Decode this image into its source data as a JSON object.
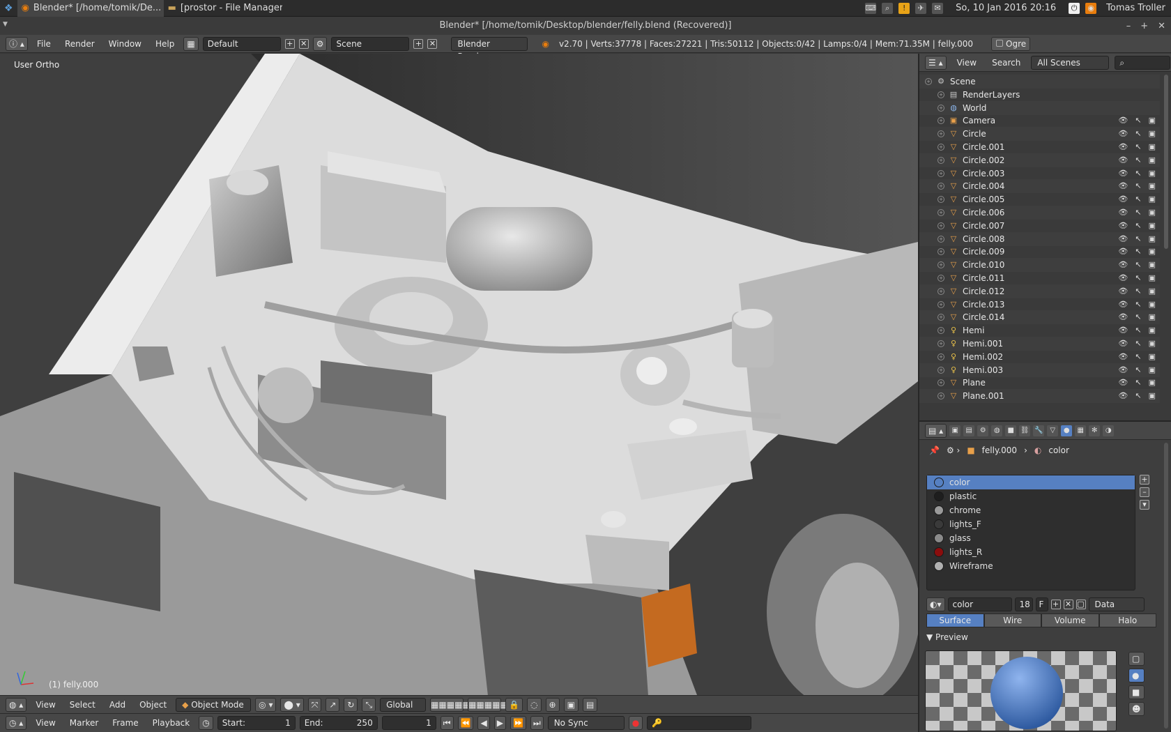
{
  "system": {
    "tasks": [
      {
        "label": "Blender* [/home/tomik/De..."
      },
      {
        "label": "[prostor - File Manager]"
      }
    ],
    "clock": "So, 10 Jan 2016 20:16",
    "user": "Tomas Troller"
  },
  "window": {
    "title": "Blender* [/home/tomik/Desktop/blender/felly.blend (Recovered)]"
  },
  "info_header": {
    "menus": [
      "File",
      "Render",
      "Window",
      "Help"
    ],
    "layout": "Default",
    "scene": "Scene",
    "engine": "Blender Render",
    "stats": "v2.70 | Verts:37778 | Faces:27221 | Tris:50112 | Objects:0/42 | Lamps:0/4 | Mem:71.35M | felly.000",
    "ogre_label": "Ogre"
  },
  "viewport": {
    "view_label": "User Ortho",
    "object_label": "(1) felly.000"
  },
  "view3d_header": {
    "menus": [
      "View",
      "Select",
      "Add",
      "Object"
    ],
    "mode": "Object Mode",
    "orientation": "Global"
  },
  "timeline": {
    "menus": [
      "View",
      "Marker",
      "Frame",
      "Playback"
    ],
    "start_label": "Start:",
    "start": "1",
    "end_label": "End:",
    "end": "250",
    "current": "1",
    "sync": "No Sync"
  },
  "outliner": {
    "menus": [
      "View",
      "Search"
    ],
    "filter": "All Scenes",
    "items": [
      {
        "name": "Scene",
        "type": "scene",
        "indent": 0
      },
      {
        "name": "RenderLayers",
        "type": "renderlayers",
        "indent": 1
      },
      {
        "name": "World",
        "type": "world",
        "indent": 1
      },
      {
        "name": "Camera",
        "type": "camera",
        "indent": 1
      },
      {
        "name": "Circle",
        "type": "mesh",
        "indent": 1
      },
      {
        "name": "Circle.001",
        "type": "mesh",
        "indent": 1
      },
      {
        "name": "Circle.002",
        "type": "mesh",
        "indent": 1
      },
      {
        "name": "Circle.003",
        "type": "mesh",
        "indent": 1
      },
      {
        "name": "Circle.004",
        "type": "mesh",
        "indent": 1
      },
      {
        "name": "Circle.005",
        "type": "mesh",
        "indent": 1
      },
      {
        "name": "Circle.006",
        "type": "mesh",
        "indent": 1
      },
      {
        "name": "Circle.007",
        "type": "mesh",
        "indent": 1
      },
      {
        "name": "Circle.008",
        "type": "mesh",
        "indent": 1
      },
      {
        "name": "Circle.009",
        "type": "mesh",
        "indent": 1
      },
      {
        "name": "Circle.010",
        "type": "mesh",
        "indent": 1
      },
      {
        "name": "Circle.011",
        "type": "mesh",
        "indent": 1
      },
      {
        "name": "Circle.012",
        "type": "mesh",
        "indent": 1
      },
      {
        "name": "Circle.013",
        "type": "mesh",
        "indent": 1
      },
      {
        "name": "Circle.014",
        "type": "mesh",
        "indent": 1
      },
      {
        "name": "Hemi",
        "type": "lamp",
        "indent": 1
      },
      {
        "name": "Hemi.001",
        "type": "lamp",
        "indent": 1
      },
      {
        "name": "Hemi.002",
        "type": "lamp",
        "indent": 1
      },
      {
        "name": "Hemi.003",
        "type": "lamp",
        "indent": 1
      },
      {
        "name": "Plane",
        "type": "mesh",
        "indent": 1
      },
      {
        "name": "Plane.001",
        "type": "mesh",
        "indent": 1
      }
    ]
  },
  "properties": {
    "breadcrumb_object": "felly.000",
    "breadcrumb_material": "color",
    "materials": [
      {
        "name": "color",
        "color": "#5680c2",
        "selected": true
      },
      {
        "name": "plastic",
        "color": "#1e1e1e",
        "selected": false
      },
      {
        "name": "chrome",
        "color": "#9a9a9a",
        "selected": false
      },
      {
        "name": "lights_F",
        "color": "#3a3a3a",
        "selected": false
      },
      {
        "name": "glass",
        "color": "#8a8a8a",
        "selected": false
      },
      {
        "name": "lights_R",
        "color": "#8b0d0d",
        "selected": false
      },
      {
        "name": "Wireframe",
        "color": "#b0b0b0",
        "selected": false
      }
    ],
    "material_name": "color",
    "users": "18",
    "fake_user": "F",
    "link": "Data",
    "shading_tabs": [
      "Surface",
      "Wire",
      "Volume",
      "Halo"
    ],
    "preview_label": "Preview"
  },
  "colors": {
    "accent": "#5680c2",
    "panel": "#474747",
    "viewport": "#4b4b4b"
  }
}
